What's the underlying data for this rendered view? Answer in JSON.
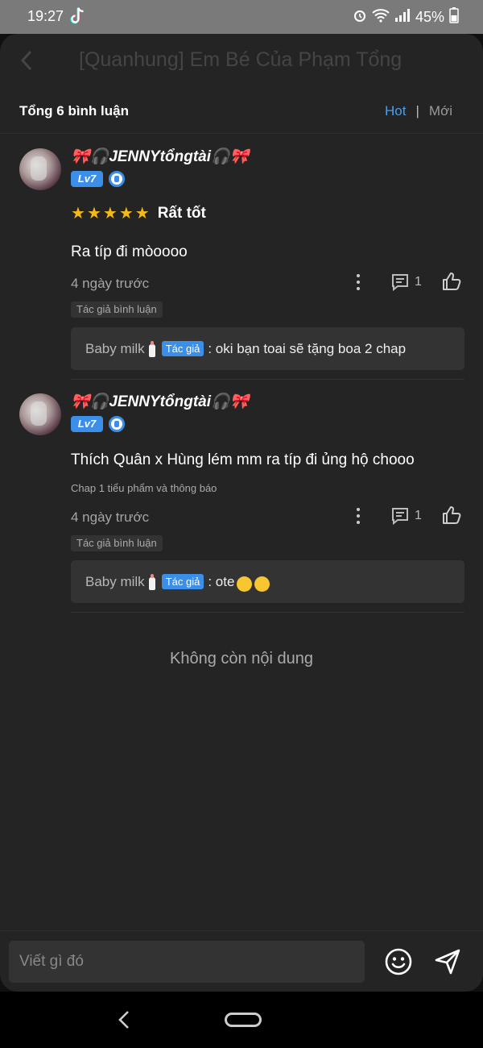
{
  "status_bar": {
    "time": "19:27",
    "battery": "45%",
    "icons": [
      "tiktok-icon",
      "alarm-icon",
      "wifi-icon",
      "signal-icon",
      "battery-icon"
    ]
  },
  "background_page": {
    "title": "[Quanhung] Em Bé Của Phạm Tổng"
  },
  "comments_sheet": {
    "total_label": "Tổng 6 bình luận",
    "sort": {
      "hot": "Hot",
      "separator": "|",
      "new": "Mới"
    },
    "comments": [
      {
        "username": "🎀🎧JENNYtổngtài🎧🎀",
        "level": "Lv7",
        "rating_label": "Rất tốt",
        "stars": 5,
        "text": "Ra típ đi mòoooo",
        "chapter": "",
        "time": "4 ngày trước",
        "reply_count": "1",
        "author_tag": "Tác giả bình luận",
        "reply": {
          "user": "Baby milk",
          "badge": "Tác giả",
          "text": ": oki bạn toai sẽ tặng boa 2 chap"
        }
      },
      {
        "username": "🎀🎧JENNYtổngtài🎧🎀",
        "level": "Lv7",
        "rating_label": "",
        "stars": 0,
        "text": "Thích Quân x Hùng lém mm ra típ đi ủng hộ chooo",
        "chapter": "Chap 1 tiểu phẩm và thông báo",
        "time": "4 ngày trước",
        "reply_count": "1",
        "author_tag": "Tác giả bình luận",
        "reply": {
          "user": "Baby milk",
          "badge": "Tác giả",
          "text": ": ote"
        }
      }
    ],
    "no_more": "Không còn nội dung",
    "input_placeholder": "Viết gì đó"
  },
  "colors": {
    "accent": "#3b8fe8",
    "sheet_bg": "#242424",
    "star": "#f5b916"
  }
}
